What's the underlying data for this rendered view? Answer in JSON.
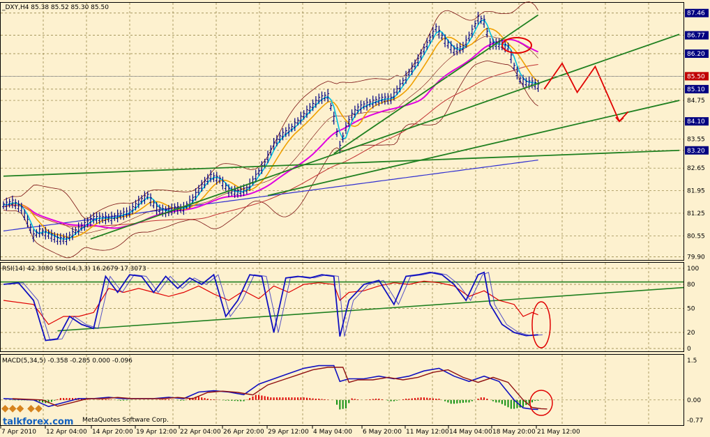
{
  "colors": {
    "background": "#fdf1cf",
    "grid": "#8a7a3a",
    "price_bar": "#000080",
    "bollinger": "#7a1010",
    "ma_fast": "#00c0e0",
    "ma_mid": "#f0a000",
    "ma_slow": "#e000e0",
    "ma_long": "#c03030",
    "ma_200": "#3030d0",
    "trendline": "#208020",
    "projection": "#e00000",
    "rsi": "#e00000",
    "stoch_main": "#1010c0",
    "stoch_signal": "#1010c0",
    "macd_line": "#1010c0",
    "macd_signal": "#901010",
    "hist_pos": "#e00000",
    "hist_neg": "#109010",
    "price_box_bg": "#000080",
    "current_box_bg": "#c00000"
  },
  "header": {
    "main": "_DXY,H4  85.38 85.52 85.30 85.50"
  },
  "price_panel": {
    "ticks": [
      "87.46",
      "86.77",
      "86.20",
      "85.50",
      "85.10",
      "84.75",
      "84.10",
      "83.55",
      "83.20",
      "82.65",
      "81.95",
      "81.25",
      "80.55",
      "79.90"
    ],
    "boxed": [
      "87.46",
      "86.77",
      "86.20",
      "85.10",
      "84.10",
      "83.20"
    ],
    "current": "85.50"
  },
  "rsi_panel": {
    "header": "RSI(14) 42.3080   Sto(14,3,3) 16.2679 17.3073",
    "ticks": [
      "100",
      "80",
      "50",
      "20",
      "0"
    ]
  },
  "macd_panel": {
    "header": "MACD(5,34,5) -0.358 -0.285 0.000 -0.096",
    "ticks": [
      "1.5",
      "0.00",
      "-0.77"
    ]
  },
  "time_axis": [
    "7 Apr 2010",
    "12 Apr 04:00",
    "14 Apr 20:00",
    "19 Apr 12:00",
    "22 Apr 04:00",
    "26 Apr 20:00",
    "29 Apr 12:00",
    "4 May 04:00",
    "6 May 20:00",
    "11 May 12:00",
    "14 May 04:00",
    "18 May 20:00",
    "21 May 12:00"
  ],
  "watermark": {
    "site": "talkforex.com",
    "copyright": "MetaQuotes Software Corp."
  },
  "chart_data": {
    "type": "line",
    "price_series": [
      [
        0,
        81.5
      ],
      [
        3,
        81.6
      ],
      [
        6,
        81.4
      ],
      [
        8,
        81.0
      ],
      [
        10,
        80.55
      ],
      [
        12,
        80.7
      ],
      [
        15,
        80.6
      ],
      [
        18,
        80.45
      ],
      [
        21,
        80.45
      ],
      [
        24,
        80.7
      ],
      [
        27,
        80.9
      ],
      [
        30,
        81.1
      ],
      [
        33,
        81.1
      ],
      [
        36,
        81.1
      ],
      [
        39,
        81.2
      ],
      [
        42,
        81.3
      ],
      [
        45,
        81.6
      ],
      [
        48,
        81.8
      ],
      [
        51,
        81.4
      ],
      [
        54,
        81.3
      ],
      [
        57,
        81.4
      ],
      [
        60,
        81.4
      ],
      [
        63,
        81.7
      ],
      [
        66,
        82.1
      ],
      [
        69,
        82.4
      ],
      [
        72,
        82.3
      ],
      [
        75,
        81.95
      ],
      [
        78,
        81.9
      ],
      [
        81,
        82.0
      ],
      [
        84,
        82.4
      ],
      [
        87,
        82.8
      ],
      [
        90,
        83.4
      ],
      [
        93,
        83.7
      ],
      [
        96,
        83.9
      ],
      [
        99,
        84.2
      ],
      [
        102,
        84.5
      ],
      [
        105,
        84.8
      ],
      [
        108,
        84.9
      ],
      [
        110,
        84.2
      ],
      [
        112,
        83.3
      ],
      [
        114,
        83.9
      ],
      [
        116,
        84.3
      ],
      [
        118,
        84.5
      ],
      [
        120,
        84.6
      ],
      [
        123,
        84.7
      ],
      [
        126,
        84.8
      ],
      [
        129,
        84.8
      ],
      [
        132,
        85.2
      ],
      [
        135,
        85.6
      ],
      [
        138,
        86.0
      ],
      [
        141,
        86.5
      ],
      [
        144,
        87.0
      ],
      [
        147,
        86.6
      ],
      [
        150,
        86.3
      ],
      [
        153,
        86.4
      ],
      [
        156,
        86.9
      ],
      [
        158,
        87.3
      ],
      [
        160,
        87.2
      ],
      [
        162,
        86.5
      ],
      [
        165,
        86.5
      ],
      [
        168,
        86.4
      ],
      [
        170,
        85.8
      ],
      [
        172,
        85.4
      ],
      [
        174,
        85.3
      ],
      [
        176,
        85.3
      ],
      [
        178,
        85.2
      ]
    ],
    "projection": [
      [
        180,
        85.1
      ],
      [
        186,
        85.9
      ],
      [
        191,
        85.0
      ],
      [
        197,
        85.8
      ],
      [
        205,
        84.1
      ],
      [
        208,
        84.4
      ]
    ],
    "trendlines": [
      {
        "from": [
          29,
          80.45
        ],
        "to": [
          225,
          86.8
        ]
      },
      {
        "from": [
          0,
          82.4
        ],
        "to": [
          225,
          83.2
        ]
      },
      {
        "from": [
          88,
          81.8
        ],
        "to": [
          225,
          84.75
        ]
      },
      {
        "from": [
          110,
          83.1
        ],
        "to": [
          178,
          87.4
        ]
      }
    ],
    "rsi": [
      [
        0,
        60
      ],
      [
        10,
        55
      ],
      [
        15,
        30
      ],
      [
        20,
        40
      ],
      [
        25,
        40
      ],
      [
        30,
        45
      ],
      [
        35,
        75
      ],
      [
        40,
        70
      ],
      [
        45,
        75
      ],
      [
        50,
        70
      ],
      [
        55,
        65
      ],
      [
        60,
        70
      ],
      [
        65,
        78
      ],
      [
        70,
        68
      ],
      [
        75,
        60
      ],
      [
        80,
        72
      ],
      [
        85,
        62
      ],
      [
        90,
        78
      ],
      [
        95,
        70
      ],
      [
        100,
        80
      ],
      [
        105,
        82
      ],
      [
        110,
        80
      ],
      [
        112,
        60
      ],
      [
        115,
        70
      ],
      [
        120,
        72
      ],
      [
        125,
        78
      ],
      [
        130,
        82
      ],
      [
        135,
        80
      ],
      [
        140,
        84
      ],
      [
        145,
        82
      ],
      [
        150,
        78
      ],
      [
        155,
        65
      ],
      [
        160,
        72
      ],
      [
        165,
        60
      ],
      [
        170,
        55
      ],
      [
        173,
        40
      ],
      [
        176,
        45
      ],
      [
        178,
        42
      ]
    ],
    "stoch": [
      [
        0,
        80
      ],
      [
        5,
        82
      ],
      [
        10,
        60
      ],
      [
        14,
        10
      ],
      [
        18,
        12
      ],
      [
        22,
        40
      ],
      [
        26,
        30
      ],
      [
        30,
        25
      ],
      [
        34,
        90
      ],
      [
        38,
        70
      ],
      [
        42,
        92
      ],
      [
        46,
        90
      ],
      [
        50,
        70
      ],
      [
        54,
        90
      ],
      [
        58,
        75
      ],
      [
        62,
        88
      ],
      [
        66,
        80
      ],
      [
        70,
        92
      ],
      [
        74,
        40
      ],
      [
        78,
        60
      ],
      [
        82,
        92
      ],
      [
        86,
        90
      ],
      [
        90,
        20
      ],
      [
        94,
        88
      ],
      [
        98,
        90
      ],
      [
        102,
        88
      ],
      [
        106,
        92
      ],
      [
        110,
        90
      ],
      [
        112,
        15
      ],
      [
        115,
        60
      ],
      [
        120,
        80
      ],
      [
        125,
        85
      ],
      [
        130,
        55
      ],
      [
        134,
        90
      ],
      [
        138,
        92
      ],
      [
        142,
        95
      ],
      [
        146,
        92
      ],
      [
        150,
        80
      ],
      [
        154,
        60
      ],
      [
        158,
        92
      ],
      [
        160,
        95
      ],
      [
        162,
        55
      ],
      [
        166,
        30
      ],
      [
        170,
        20
      ],
      [
        174,
        16
      ],
      [
        178,
        17
      ]
    ],
    "macd": [
      [
        0,
        0.05
      ],
      [
        10,
        0.0
      ],
      [
        15,
        -0.25
      ],
      [
        20,
        -0.1
      ],
      [
        25,
        0.05
      ],
      [
        30,
        0.05
      ],
      [
        35,
        0.1
      ],
      [
        40,
        0.05
      ],
      [
        45,
        0.05
      ],
      [
        50,
        0.05
      ],
      [
        55,
        0.1
      ],
      [
        60,
        0.05
      ],
      [
        65,
        0.3
      ],
      [
        70,
        0.35
      ],
      [
        75,
        0.3
      ],
      [
        80,
        0.2
      ],
      [
        85,
        0.6
      ],
      [
        90,
        0.8
      ],
      [
        95,
        1.0
      ],
      [
        100,
        1.2
      ],
      [
        105,
        1.3
      ],
      [
        110,
        1.3
      ],
      [
        112,
        0.7
      ],
      [
        115,
        0.8
      ],
      [
        120,
        0.8
      ],
      [
        125,
        0.9
      ],
      [
        130,
        0.8
      ],
      [
        135,
        0.9
      ],
      [
        140,
        1.1
      ],
      [
        145,
        1.2
      ],
      [
        150,
        0.9
      ],
      [
        155,
        0.7
      ],
      [
        160,
        0.9
      ],
      [
        165,
        0.7
      ],
      [
        170,
        0.0
      ],
      [
        173,
        -0.3
      ],
      [
        176,
        -0.35
      ],
      [
        178,
        -0.36
      ]
    ],
    "xlim": [
      0,
      225
    ],
    "ylim_price": [
      79.8,
      87.8
    ]
  }
}
